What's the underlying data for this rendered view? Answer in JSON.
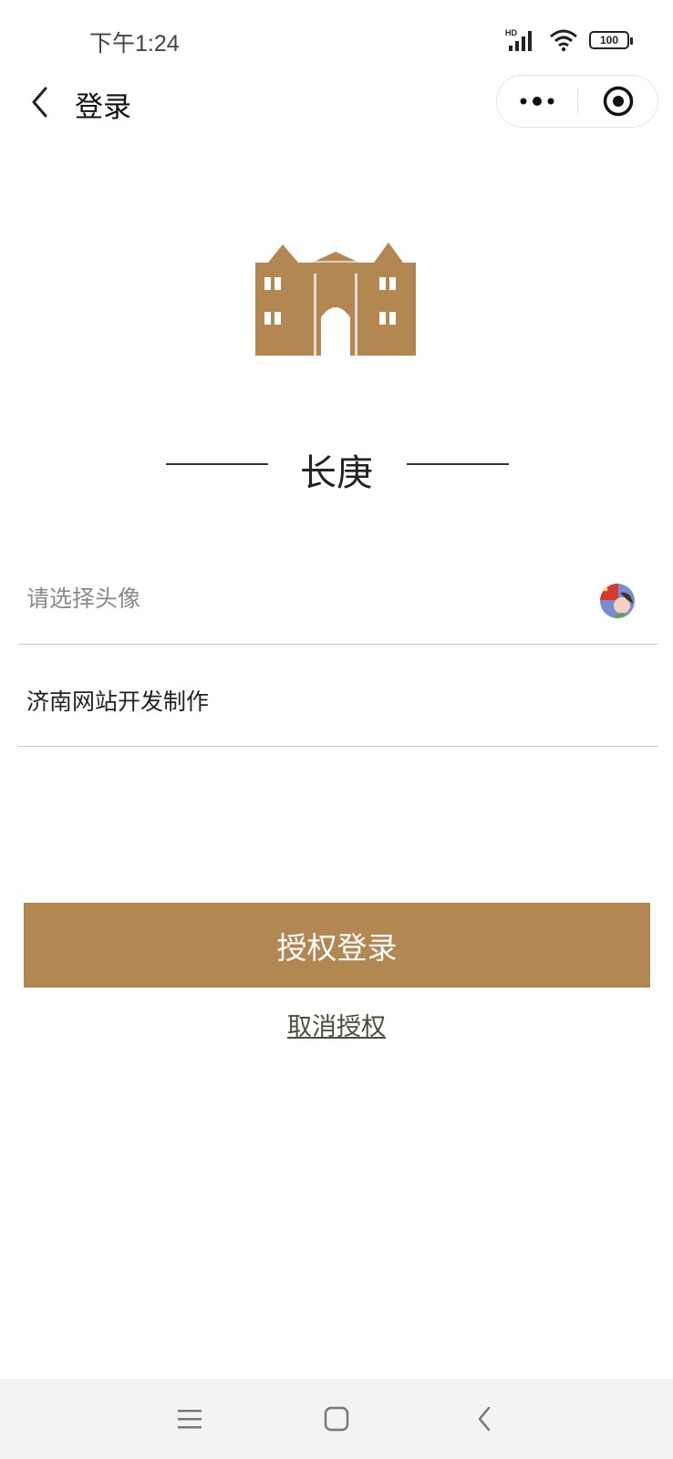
{
  "status_bar": {
    "time": "下午1:24",
    "network_label": "HD",
    "battery_level": "100",
    "icons": [
      "signal-icon",
      "wifi-icon",
      "battery-icon"
    ]
  },
  "nav": {
    "title": "登录",
    "icons": [
      "back-icon",
      "more-dots-icon",
      "target-icon"
    ]
  },
  "brand": {
    "name": "长庚",
    "logo_icon": "building-logo-icon",
    "accent_color": "#b28751"
  },
  "form": {
    "avatar_label": "请选择头像",
    "nickname_value": "济南网站开发制作"
  },
  "actions": {
    "login_label": "授权登录",
    "cancel_label": "取消授权"
  },
  "system_nav": {
    "icons": [
      "menu-icon",
      "home-icon",
      "back-icon"
    ]
  }
}
